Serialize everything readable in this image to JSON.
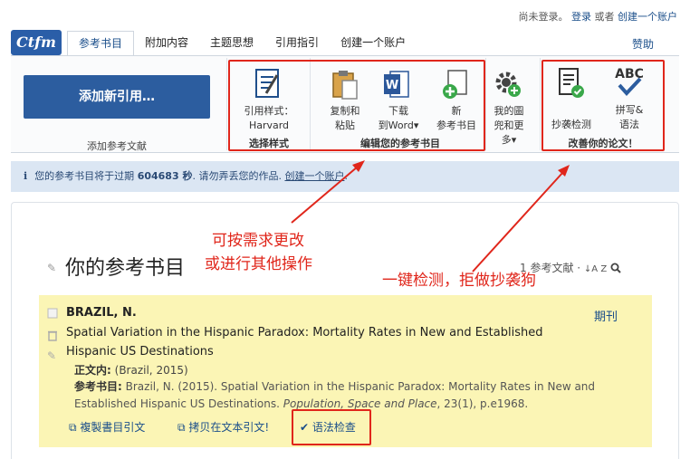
{
  "topbar": {
    "not_logged": "尚未登录。",
    "login": "登录",
    "or": "或者",
    "create": "创建一个账户"
  },
  "logo": "Ctfm",
  "tabs": [
    {
      "label": "参考书目",
      "active": true
    },
    {
      "label": "附加内容",
      "active": false
    },
    {
      "label": "主题思想",
      "active": false
    },
    {
      "label": "引用指引",
      "active": false
    },
    {
      "label": "创建一个账户",
      "active": false
    }
  ],
  "help": "赞助",
  "ribbon": {
    "add_button": "添加新引用…",
    "add_caption": "添加参考文献",
    "style_line1": "引用样式：",
    "style_line2": "Harvard",
    "style_group": "选择样式",
    "copy_line1": "复制和",
    "copy_line2": "粘贴",
    "download_line1": "下载",
    "download_line2": "到Word",
    "new_line1": "新",
    "new_line2": "参考书目",
    "edit_group": "编辑您的参考书目",
    "more_line1": "我的圖",
    "more_line2": "兜和更",
    "more_line3": "多",
    "plag_label": "抄袭检测",
    "spell_line1": "拼写&",
    "spell_line2": "语法",
    "spell_abc": "ABC",
    "improve_group": "改善你的论文！"
  },
  "info": {
    "icon": "i",
    "text_before": "您的参考书目将于过期",
    "seconds": "604683 秒",
    "text_after": ". 请勿弄丢您的作品.",
    "link": "创建一个账户",
    "end": "."
  },
  "main": {
    "title": "你的参考书目",
    "count": "1 参考文献",
    "sort_icon": "↓A Z"
  },
  "annotations": {
    "left_line1": "可按需求更改",
    "left_line2": "或进行其他操作",
    "right": "一键检测，拒做抄袭狗"
  },
  "citation": {
    "author": "BRAZIL, N.",
    "title": "Spatial Variation in the Hispanic Paradox: Mortality Rates in New and Established Hispanic US Destinations",
    "type": "期刊",
    "intext_label": "正文内:",
    "intext_value": "(Brazil, 2015)",
    "ref_label": "参考书目:",
    "ref_plain": "Brazil, N. (2015). Spatial Variation in the Hispanic Paradox: Mortality Rates in New and Established Hispanic US Destinations.",
    "ref_journal": "Population, Space and Place",
    "ref_tail": ", 23(1), p.e1968.",
    "action_copy": "複製書目引文",
    "action_copy_intext": "拷贝在文本引文!",
    "action_grammar": "语法检查"
  },
  "colors": {
    "accent": "#2c5d9f",
    "annotation": "#e0261b",
    "card": "#fbf5b5",
    "info": "#dbe6f3"
  }
}
